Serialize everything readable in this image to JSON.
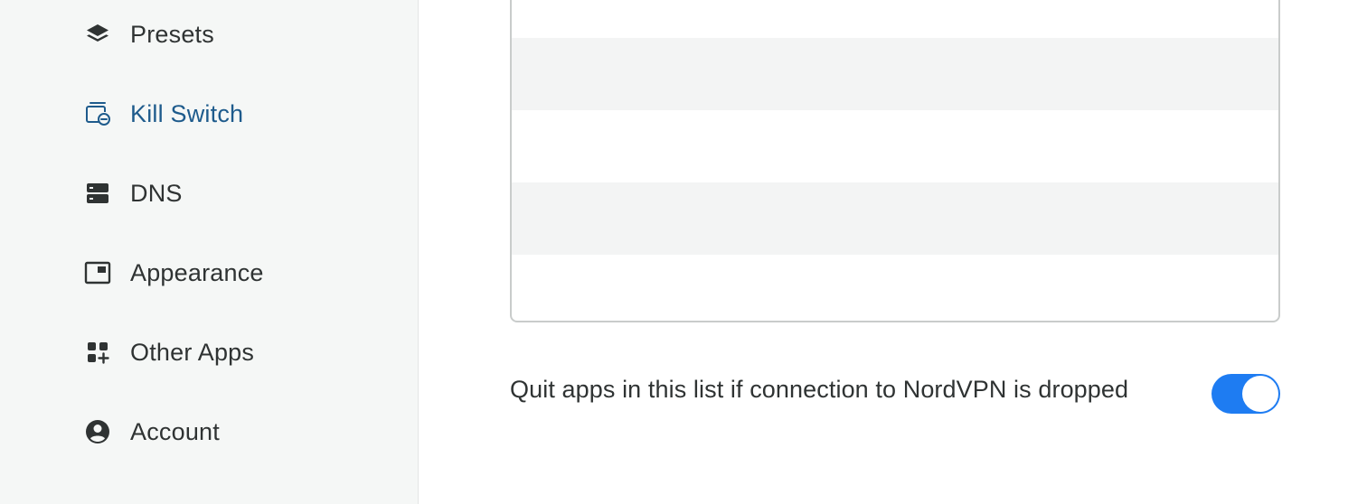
{
  "sidebar": {
    "items": [
      {
        "label": "Presets",
        "icon": "layers-icon",
        "active": false
      },
      {
        "label": "Kill Switch",
        "icon": "kill-switch-icon",
        "active": true
      },
      {
        "label": "DNS",
        "icon": "server-icon",
        "active": false
      },
      {
        "label": "Appearance",
        "icon": "window-icon",
        "active": false
      },
      {
        "label": "Other Apps",
        "icon": "apps-add-icon",
        "active": false
      },
      {
        "label": "Account",
        "icon": "user-circle-icon",
        "active": false
      }
    ]
  },
  "kill_switch": {
    "app_list_rows": 5,
    "quit_label": "Quit apps in this list if connection to NordVPN is dropped",
    "quit_toggle_on": true
  },
  "colors": {
    "accent": "#1e5b8c",
    "toggle_on": "#1e7cf2",
    "sidebar_bg": "#f5f7f6",
    "text": "#2f3333"
  }
}
